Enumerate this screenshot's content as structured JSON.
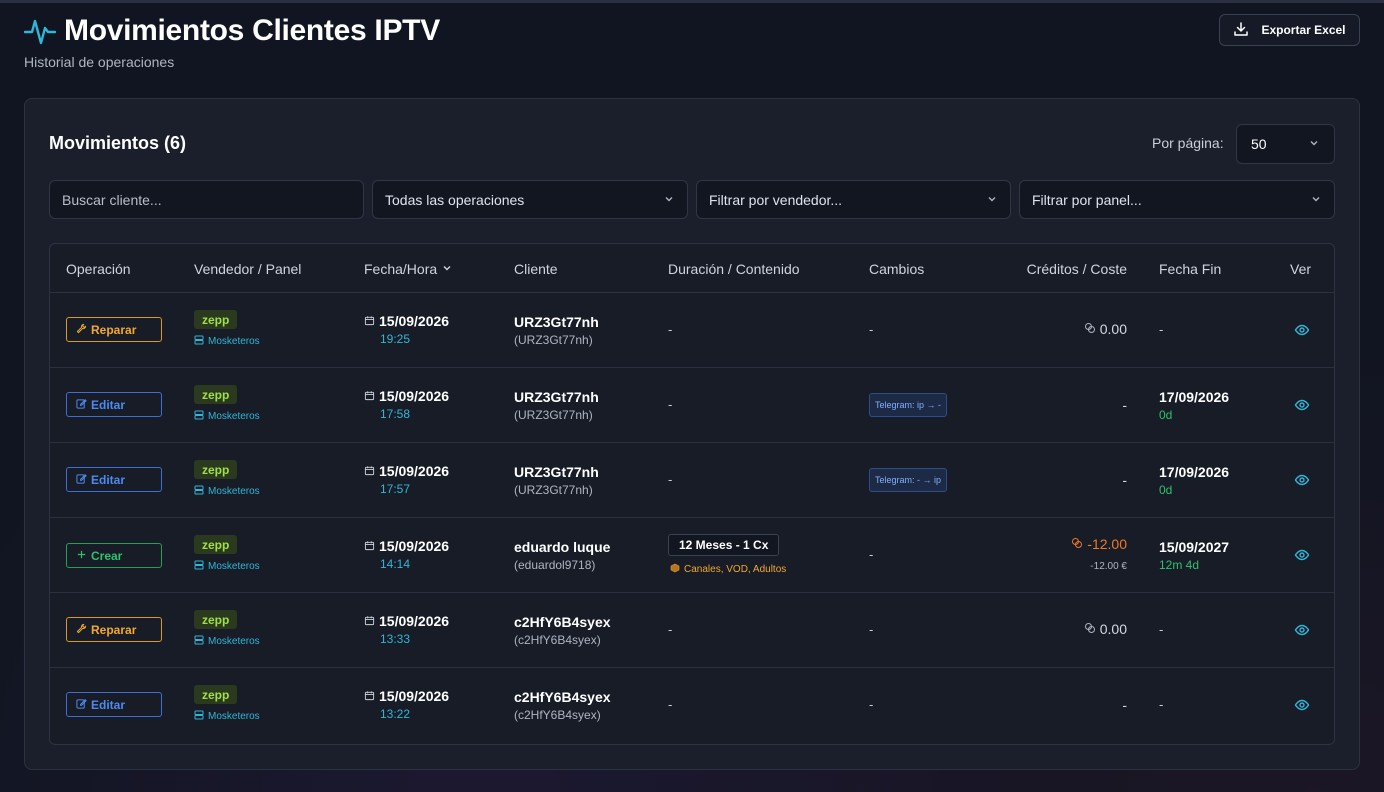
{
  "header": {
    "title": "Movimientos Clientes IPTV",
    "subtitle": "Historial de operaciones",
    "export_label": "Exportar Excel"
  },
  "card": {
    "title": "Movimientos (6)",
    "per_page_label": "Por página:",
    "per_page_value": "50"
  },
  "filters": {
    "search_placeholder": "Buscar cliente...",
    "operations": "Todas las operaciones",
    "vendor": "Filtrar por vendedor...",
    "panel": "Filtrar por panel..."
  },
  "table": {
    "columns": [
      "Operación",
      "Vendedor / Panel",
      "Fecha/Hora",
      "Cliente",
      "Duración / Contenido",
      "Cambios",
      "Créditos / Coste",
      "Fecha Fin",
      "Ver"
    ],
    "rows": [
      {
        "op": "Reparar",
        "op_type": "repair",
        "vendor": "zepp",
        "panel": "Mosketeros",
        "date": "15/09/2026",
        "time": "19:25",
        "client": "URZ3Gt77nh",
        "client_user": "(URZ3Gt77nh)",
        "duration": "-",
        "content": "",
        "changes": "-",
        "credits": "0.00",
        "credits_sub": "",
        "end_date": "-",
        "end_rem": ""
      },
      {
        "op": "Editar",
        "op_type": "edit",
        "vendor": "zepp",
        "panel": "Mosketeros",
        "date": "15/09/2026",
        "time": "17:58",
        "client": "URZ3Gt77nh",
        "client_user": "(URZ3Gt77nh)",
        "duration": "-",
        "content": "",
        "changes": "Telegram: ip → -",
        "credits": "-",
        "credits_sub": "",
        "end_date": "17/09/2026",
        "end_rem": "0d"
      },
      {
        "op": "Editar",
        "op_type": "edit",
        "vendor": "zepp",
        "panel": "Mosketeros",
        "date": "15/09/2026",
        "time": "17:57",
        "client": "URZ3Gt77nh",
        "client_user": "(URZ3Gt77nh)",
        "duration": "-",
        "content": "",
        "changes": "Telegram: - → ip",
        "credits": "-",
        "credits_sub": "",
        "end_date": "17/09/2026",
        "end_rem": "0d"
      },
      {
        "op": "Crear",
        "op_type": "create",
        "vendor": "zepp",
        "panel": "Mosketeros",
        "date": "15/09/2026",
        "time": "14:14",
        "client": "eduardo luque",
        "client_user": "(eduardol9718)",
        "duration": "12 Meses - 1 Cx",
        "content": "Canales, VOD, Adultos",
        "changes": "-",
        "credits": "-12.00",
        "credits_sub": "-12.00 €",
        "end_date": "15/09/2027",
        "end_rem": "12m 4d"
      },
      {
        "op": "Reparar",
        "op_type": "repair",
        "vendor": "zepp",
        "panel": "Mosketeros",
        "date": "15/09/2026",
        "time": "13:33",
        "client": "c2HfY6B4syex",
        "client_user": "(c2HfY6B4syex)",
        "duration": "-",
        "content": "",
        "changes": "-",
        "credits": "0.00",
        "credits_sub": "",
        "end_date": "-",
        "end_rem": ""
      },
      {
        "op": "Editar",
        "op_type": "edit",
        "vendor": "zepp",
        "panel": "Mosketeros",
        "date": "15/09/2026",
        "time": "13:22",
        "client": "c2HfY6B4syex",
        "client_user": "(c2HfY6B4syex)",
        "duration": "-",
        "content": "",
        "changes": "-",
        "credits": "-",
        "credits_sub": "",
        "end_date": "-",
        "end_rem": ""
      }
    ]
  },
  "colors": {
    "accent": "#2fb6d8",
    "repair": "#f2a92a",
    "edit": "#4d8af0",
    "create": "#2ec26a",
    "negative": "#f0782a"
  }
}
